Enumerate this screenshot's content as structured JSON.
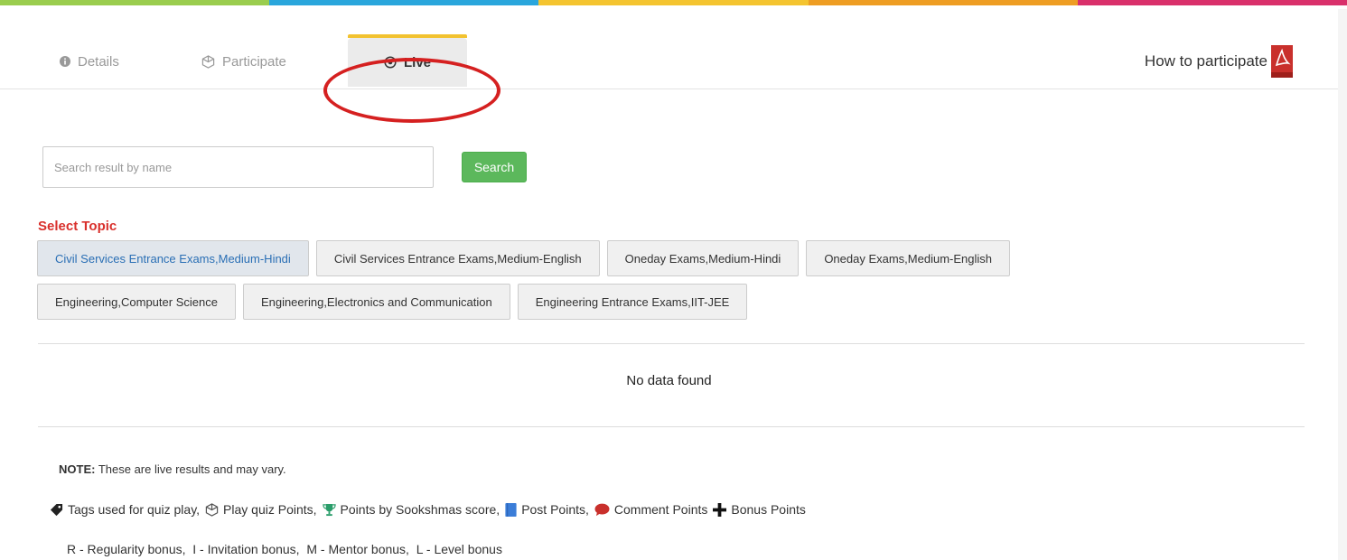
{
  "colors": {
    "bar": [
      "#9acd4e",
      "#2aa6dc",
      "#f4c430",
      "#ee9d23",
      "#d9306b"
    ],
    "accent": "#5cb85c",
    "topic_label": "#d9302c"
  },
  "tabs": [
    {
      "label": "Details",
      "icon": "info-icon"
    },
    {
      "label": "Participate",
      "icon": "cube-icon"
    },
    {
      "label": "Live",
      "icon": "radio-dot-icon"
    }
  ],
  "howto": {
    "label": "How to participate",
    "icon": "pdf-icon"
  },
  "search": {
    "placeholder": "Search result by name",
    "value": "",
    "button": "Search"
  },
  "select_topic": "Select Topic",
  "topics": [
    "Civil Services Entrance Exams,Medium-Hindi",
    "Civil Services Entrance Exams,Medium-English",
    "Oneday Exams,Medium-Hindi",
    "Oneday Exams,Medium-English",
    "Engineering,Computer Science",
    "Engineering,Electronics and Communication",
    "Engineering Entrance Exams,IIT-JEE"
  ],
  "no_data": "No data found",
  "note": {
    "label": "NOTE:",
    "text": " These are live results and may vary."
  },
  "legend": [
    {
      "icon": "tag-icon",
      "label": "Tags used for quiz play,"
    },
    {
      "icon": "cube-icon",
      "label": "Play quiz Points,"
    },
    {
      "icon": "trophy-icon",
      "label": "Points by Sookshmas score,"
    },
    {
      "icon": "book-icon",
      "label": "Post Points,"
    },
    {
      "icon": "comment-icon",
      "label": "Comment Points"
    },
    {
      "icon": "plus-icon",
      "label": "Bonus Points"
    }
  ],
  "bonus_line": "R - Regularity bonus,  I - Invitation bonus,  M - Mentor bonus,  L - Level bonus"
}
